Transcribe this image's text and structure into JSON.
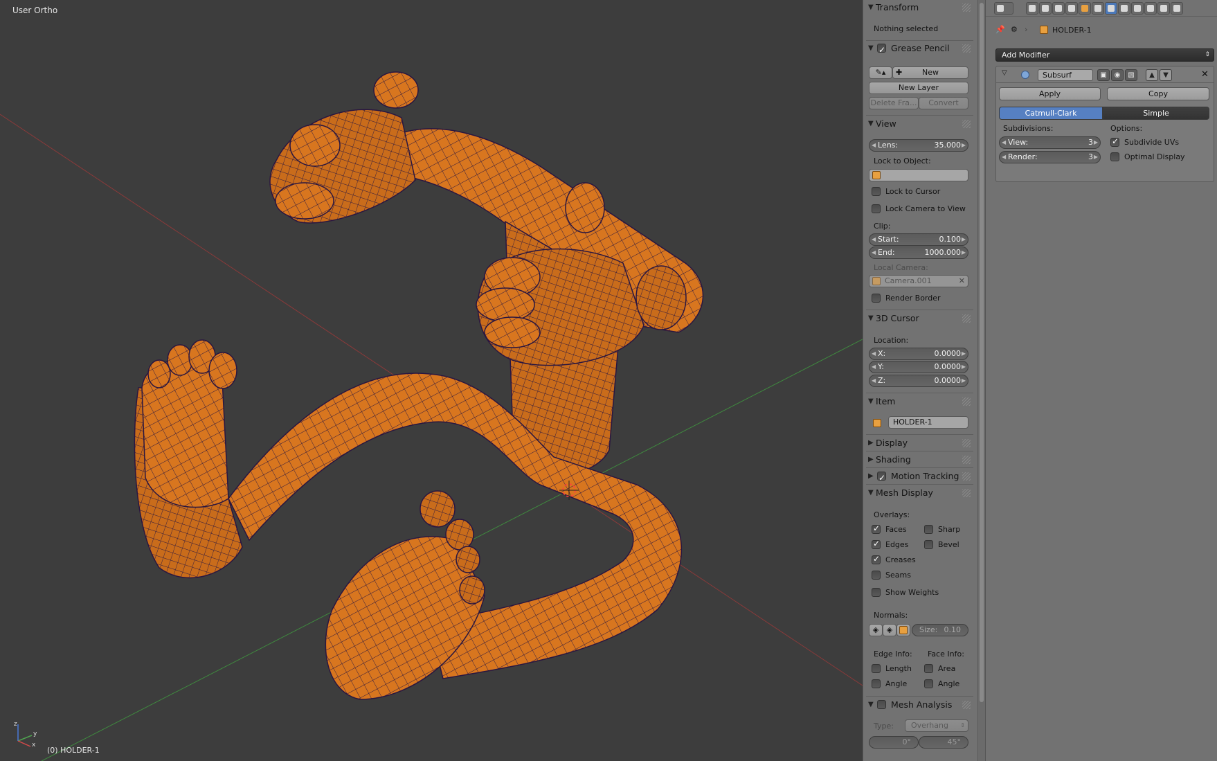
{
  "viewport": {
    "title": "User Ortho",
    "status": "(0) HOLDER-1",
    "axes": {
      "x": "x",
      "y": "y",
      "z": "z"
    }
  },
  "npanel": {
    "transform": {
      "title": "Transform",
      "info": "Nothing selected"
    },
    "grease_pencil": {
      "title": "Grease Pencil",
      "enabled": true,
      "new_label": "New",
      "new_layer_label": "New Layer",
      "delete_frame_label": "Delete Fra...",
      "convert_label": "Convert"
    },
    "view": {
      "title": "View",
      "lens_label": "Lens:",
      "lens_value": "35.000",
      "lock_to_object_label": "Lock to Object:",
      "lock_to_cursor_label": "Lock to Cursor",
      "lock_to_cursor": false,
      "lock_camera_label": "Lock Camera to View",
      "lock_camera": false,
      "clip_label": "Clip:",
      "start_label": "Start:",
      "start_value": "0.100",
      "end_label": "End:",
      "end_value": "1000.000",
      "local_camera_label": "Local Camera:",
      "local_camera_value": "Camera.001",
      "render_border_label": "Render Border",
      "render_border": false
    },
    "cursor3d": {
      "title": "3D Cursor",
      "location_label": "Location:",
      "x_label": "X:",
      "x": "0.0000",
      "y_label": "Y:",
      "y": "0.0000",
      "z_label": "Z:",
      "z": "0.0000"
    },
    "item": {
      "title": "Item",
      "name": "HOLDER-1"
    },
    "display": {
      "title": "Display"
    },
    "shading": {
      "title": "Shading"
    },
    "motion_tracking": {
      "title": "Motion Tracking",
      "enabled": true
    },
    "mesh_display": {
      "title": "Mesh Display",
      "overlays_label": "Overlays:",
      "faces": "Faces",
      "sharp": "Sharp",
      "edges": "Edges",
      "bevel": "Bevel",
      "creases": "Creases",
      "seams": "Seams",
      "show_weights": "Show Weights",
      "normals_label": "Normals:",
      "size_label": "Size:",
      "size_value": "0.10",
      "edge_info_label": "Edge Info:",
      "face_info_label": "Face Info:",
      "length": "Length",
      "area": "Area",
      "angle_edge": "Angle",
      "angle_face": "Angle"
    },
    "mesh_analysis": {
      "title": "Mesh Analysis",
      "enabled": false,
      "type_label": "Type:",
      "type_value": "Overhang",
      "min_value": "0°",
      "max_value": "45°"
    }
  },
  "properties": {
    "breadcrumb_object": "HOLDER-1",
    "add_modifier_label": "Add Modifier",
    "modifier": {
      "name": "Subsurf",
      "apply_label": "Apply",
      "copy_label": "Copy",
      "catmull_label": "Catmull-Clark",
      "simple_label": "Simple",
      "subdivisions_label": "Subdivisions:",
      "options_label": "Options:",
      "view_label": "View:",
      "view_value": "3",
      "render_label": "Render:",
      "render_value": "3",
      "subdivide_uvs_label": "Subdivide UVs",
      "subdivide_uvs": true,
      "optimal_display_label": "Optimal Display",
      "optimal_display": false
    }
  },
  "colors": {
    "mesh": "#d8761f",
    "wire": "#2a1640",
    "accent": "#5680c2",
    "bg": "#3d3d3d"
  }
}
